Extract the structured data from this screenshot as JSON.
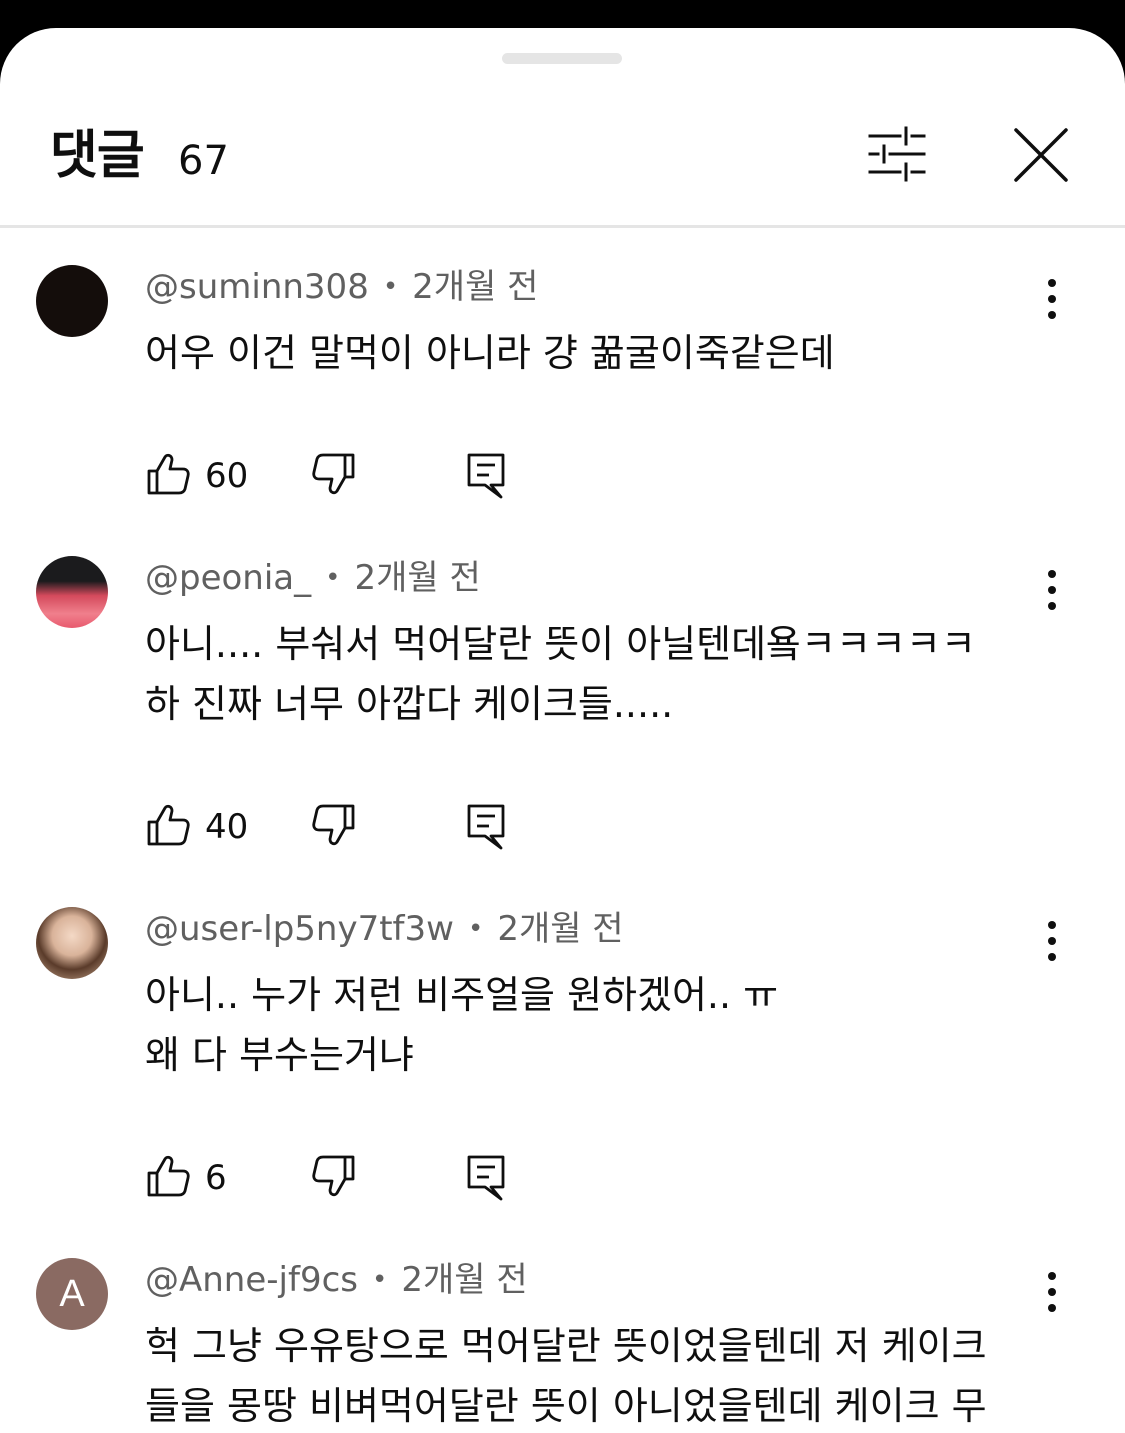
{
  "header": {
    "title": "댓글",
    "count": "67"
  },
  "comments": [
    {
      "author": "@suminn308",
      "time": "2개월 전",
      "text": "어우 이건 말먹이 아니라 걍 꿂굴이죽같은데",
      "likes": "60",
      "avatar": "dark"
    },
    {
      "author": "@peonia_",
      "time": "2개월 전",
      "text": "아니.... 부숴서 먹어달란 뜻이 아닐텐데욬ㅋㅋㅋㅋㅋ\n하 진짜 너무 아깝다 케이크들.....",
      "likes": "40",
      "avatar": "pink-flowers"
    },
    {
      "author": "@user-lp5ny7tf3w",
      "time": "2개월 전",
      "text": "아니.. 누가 저런 비주얼을 원하겠어.. ㅠ\n왜 다 부수는거냐",
      "likes": "6",
      "avatar": "photo"
    },
    {
      "author": "@Anne-jf9cs",
      "time": "2개월 전",
      "text": "헉 그냥 우유탕으로 먹어달란 뜻이었을텐데 저 케이크\n들을 몽땅 비벼먹어달란 뜻이 아니었을텐데 케이크 무",
      "avatar_letter": "A",
      "avatar": "letter"
    }
  ],
  "colors": {
    "text_primary": "#0f0f0f",
    "text_secondary": "#606060",
    "divider": "#e5e5e5",
    "letter_avatar_bg": "#8a6a62"
  },
  "icons": [
    "sort-filter-icon",
    "close-icon",
    "more-vert-icon",
    "thumb-up-icon",
    "thumb-down-icon",
    "reply-icon"
  ]
}
